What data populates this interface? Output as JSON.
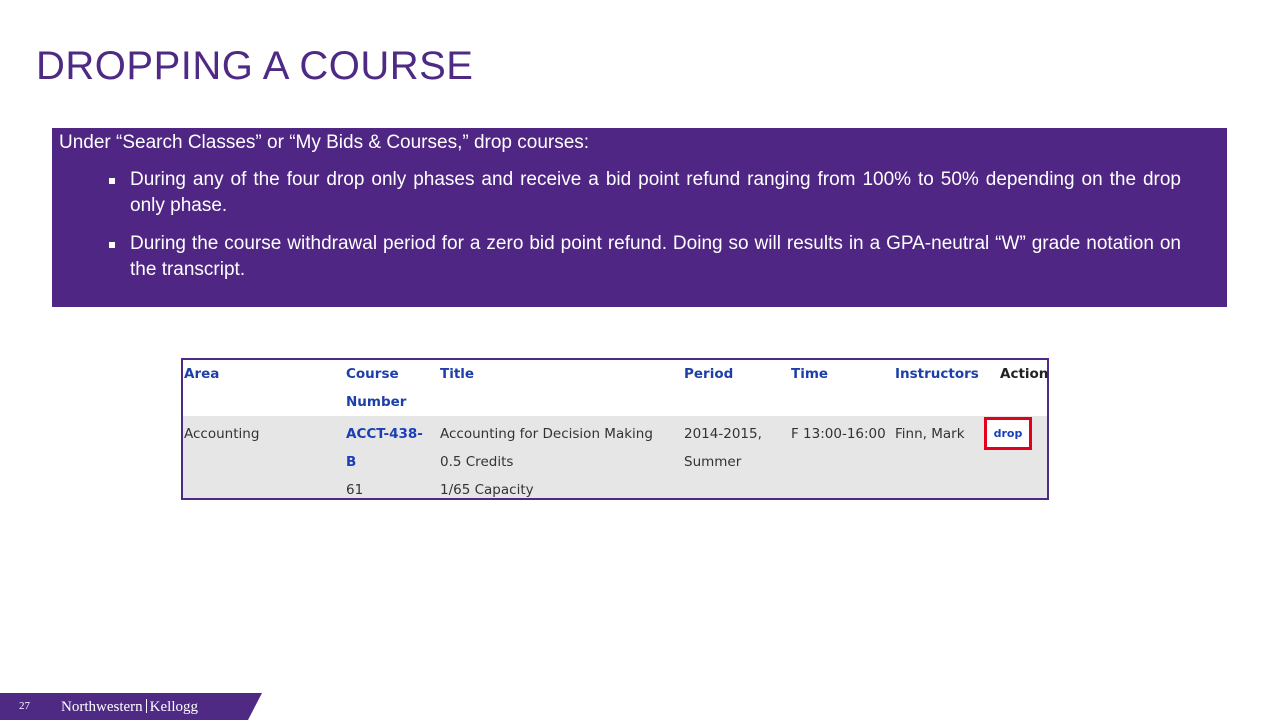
{
  "slide": {
    "title": "DROPPING A COURSE"
  },
  "info": {
    "intro": "Under “Search Classes” or “My Bids & Courses,” drop courses:",
    "bullets": [
      "During any of the four drop only phases and receive a bid point refund ranging from 100% to 50% depending on the drop only phase.",
      "During the course withdrawal period for a zero bid point refund. Doing so will results in a GPA-neutral “W” grade notation on the transcript."
    ]
  },
  "table": {
    "headers": {
      "area": "Area",
      "course_number_line1": "Course",
      "course_number_line2": "Number",
      "title": "Title",
      "period": "Period",
      "time": "Time",
      "instructors": "Instructors",
      "action": "Action"
    },
    "row": {
      "area": "Accounting",
      "course_number_line1": "ACCT-438-",
      "course_number_line2": "B",
      "course_number_line3": "61",
      "title_line1": "Accounting for Decision Making",
      "title_line2": "0.5 Credits",
      "title_line3": "1/65 Capacity",
      "period_line1": "2014-2015,",
      "period_line2": "Summer",
      "time": "F 13:00-16:00",
      "instructors": "Finn, Mark",
      "action_label": "drop"
    }
  },
  "footer": {
    "page_number": "27",
    "brand_left": "Northwestern",
    "brand_right": "Kellogg"
  },
  "colors": {
    "brand_purple": "#4e2a84",
    "box_purple": "#4f2683",
    "link_blue": "#1a3fb5",
    "highlight_red": "#e2001a"
  }
}
